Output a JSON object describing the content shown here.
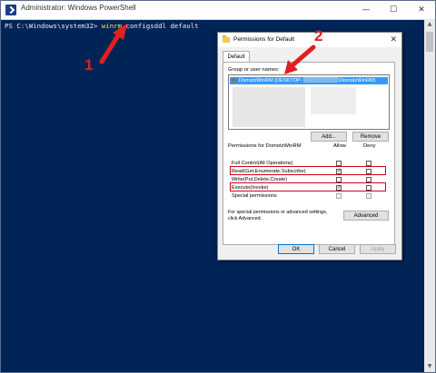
{
  "powershell": {
    "title": "Administrator: Windows PowerShell",
    "minimize": "—",
    "maximize": "☐",
    "close": "✕",
    "prompt": "PS C:\\Windows\\system32> ",
    "command": "winrm",
    "args": " configsddl default"
  },
  "dialog": {
    "title": "Permissions for Default",
    "close": "✕",
    "tab": "Default",
    "group_label": "Group or user names:",
    "users": [
      {
        "prefix": "DomotzWinRM (DESKTOP-",
        "suffix": "\\DomotzWinRM)"
      }
    ],
    "add_button": "Add...",
    "remove_button": "Remove",
    "permissions_for": "Permissions for DomotzWinRM",
    "allow_header": "Allow",
    "deny_header": "Deny",
    "permissions": [
      {
        "name": "Full Control(All Operations)",
        "allow": false,
        "deny": false
      },
      {
        "name": "Read(Get,Enumerate,Subscribe)",
        "allow": true,
        "deny": false
      },
      {
        "name": "Write(Put,Delete,Create)",
        "allow": false,
        "deny": false
      },
      {
        "name": "Execute(Invoke)",
        "allow": true,
        "deny": false
      },
      {
        "name": "Special permissions",
        "allow": false,
        "deny": false
      }
    ],
    "help_text": "For special permissions or advanced settings, click Advanced.",
    "advanced_button": "Advanced",
    "ok_button": "OK",
    "cancel_button": "Cancel",
    "apply_button": "Apply"
  },
  "annotations": {
    "one": "1",
    "two": "2",
    "color": "#e02020"
  }
}
